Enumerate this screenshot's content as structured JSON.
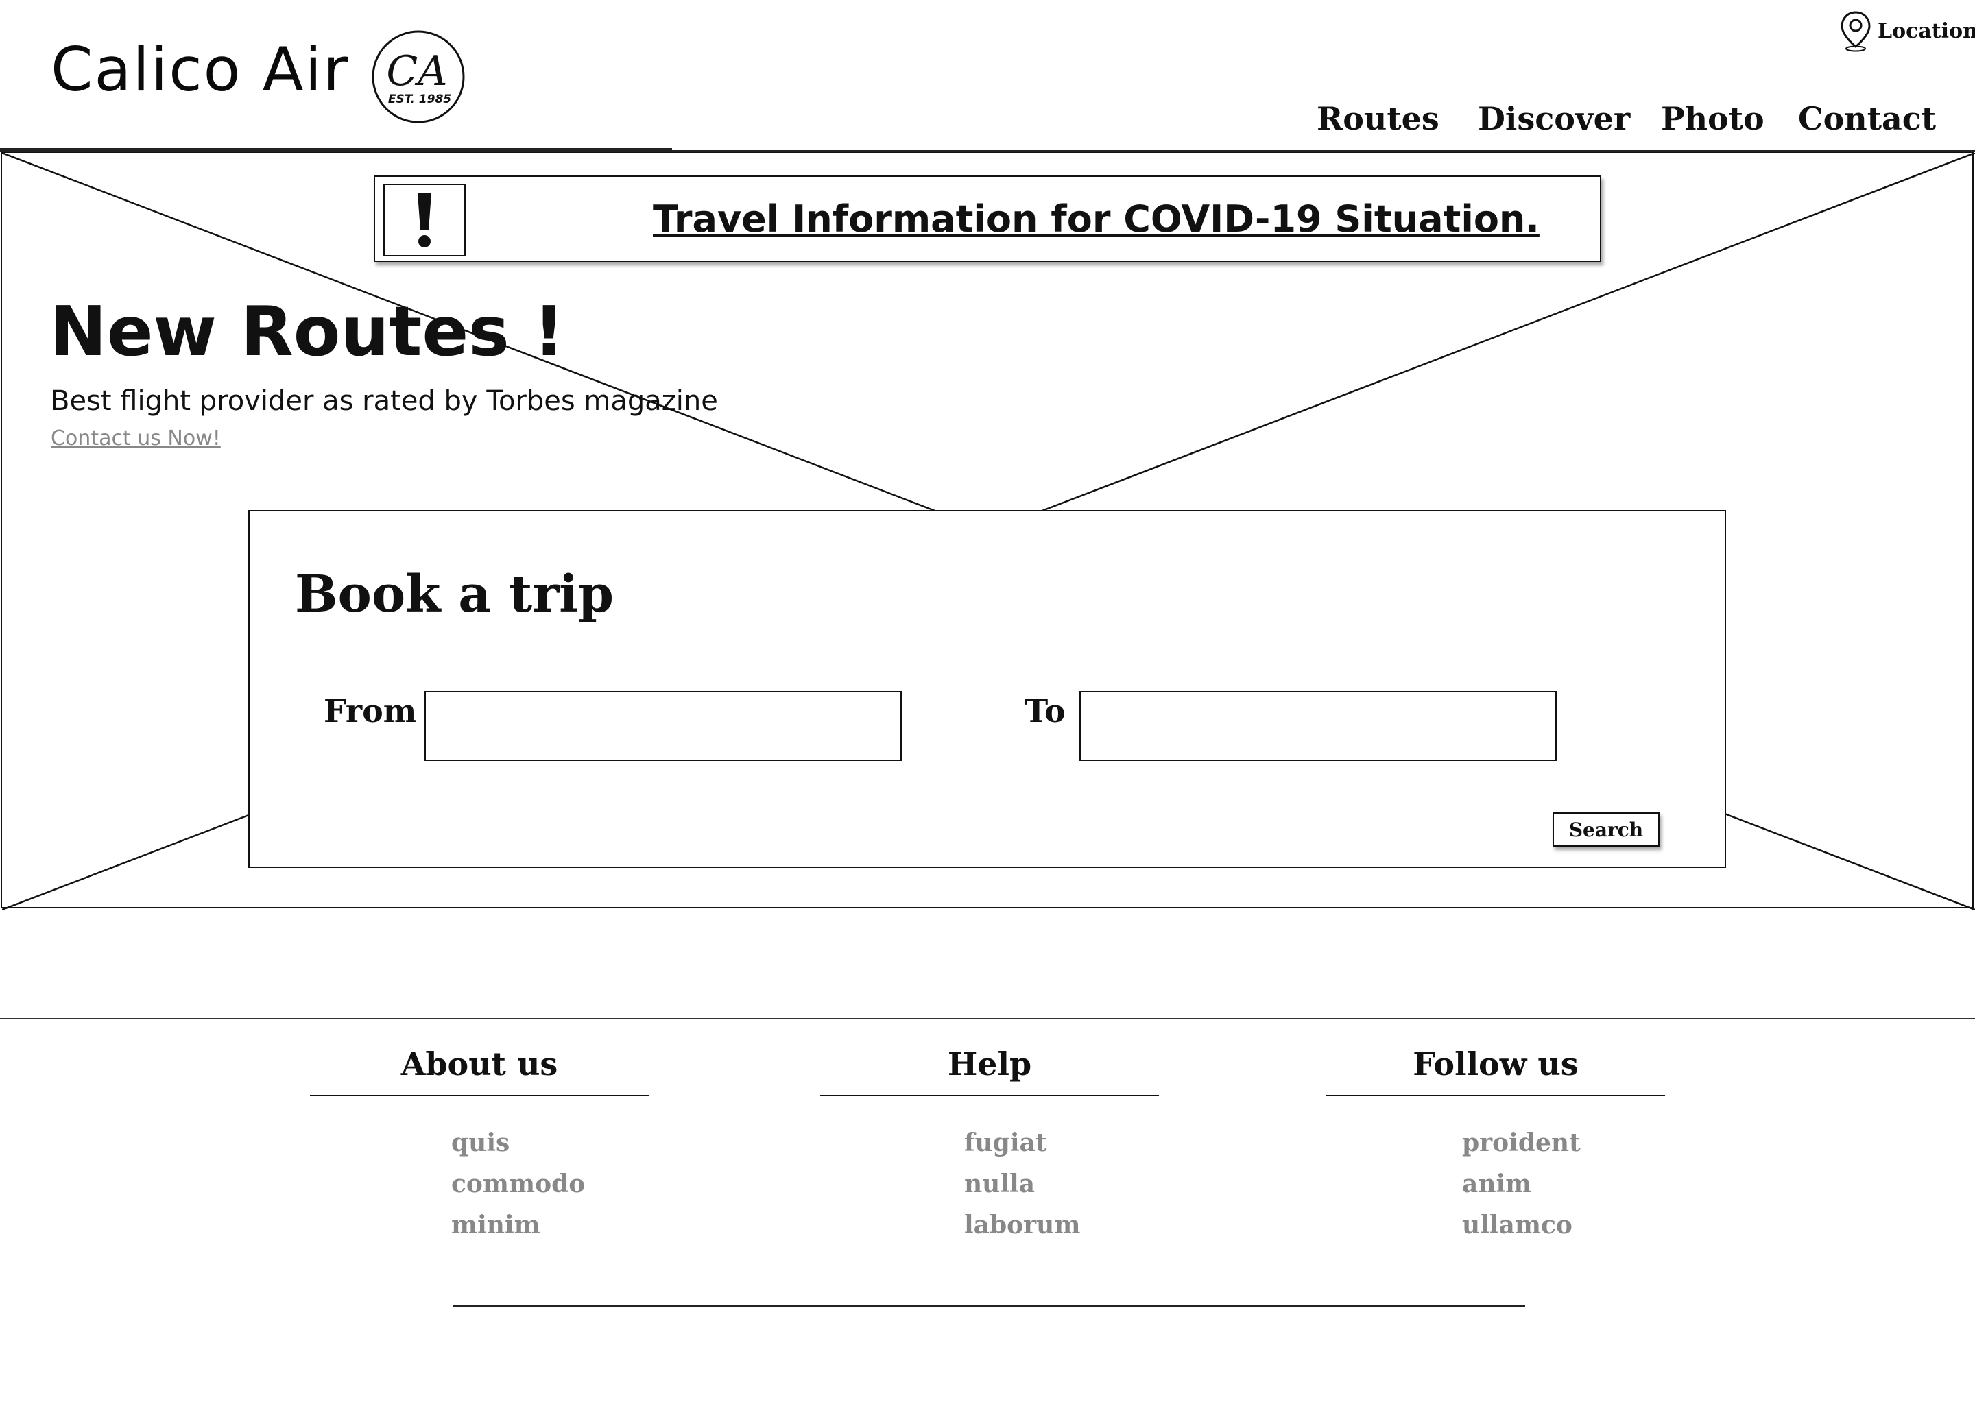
{
  "header": {
    "brand_name": "Calico Air",
    "seal_monogram": "CA",
    "seal_est": "EST. 1985",
    "location_label": "Location",
    "nav": [
      {
        "label": "Routes"
      },
      {
        "label": "Discover"
      },
      {
        "label": "Photo"
      },
      {
        "label": "Contact"
      }
    ]
  },
  "alert": {
    "icon": "exclamation-icon",
    "text": "Travel Information for COVID-19 Situation."
  },
  "hero": {
    "title": "New Routes !",
    "subtitle": "Best flight provider as rated by Torbes magazine",
    "link_text": "Contact us Now!",
    "image_placeholder": "image-placeholder-icon"
  },
  "booking": {
    "title": "Book a trip",
    "from_label": "From",
    "from_value": "",
    "to_label": "To",
    "to_value": "",
    "search_label": "Search"
  },
  "footer": {
    "columns": [
      {
        "heading": "About us",
        "links": [
          "quis",
          "commodo",
          "minim"
        ]
      },
      {
        "heading": "Help",
        "links": [
          "fugiat",
          "nulla",
          "laborum"
        ]
      },
      {
        "heading": "Follow us",
        "links": [
          "proident",
          "anim",
          "ullamco"
        ]
      }
    ]
  },
  "colors": {
    "ink": "#111111",
    "muted_link": "#888888",
    "background": "#ffffff"
  }
}
